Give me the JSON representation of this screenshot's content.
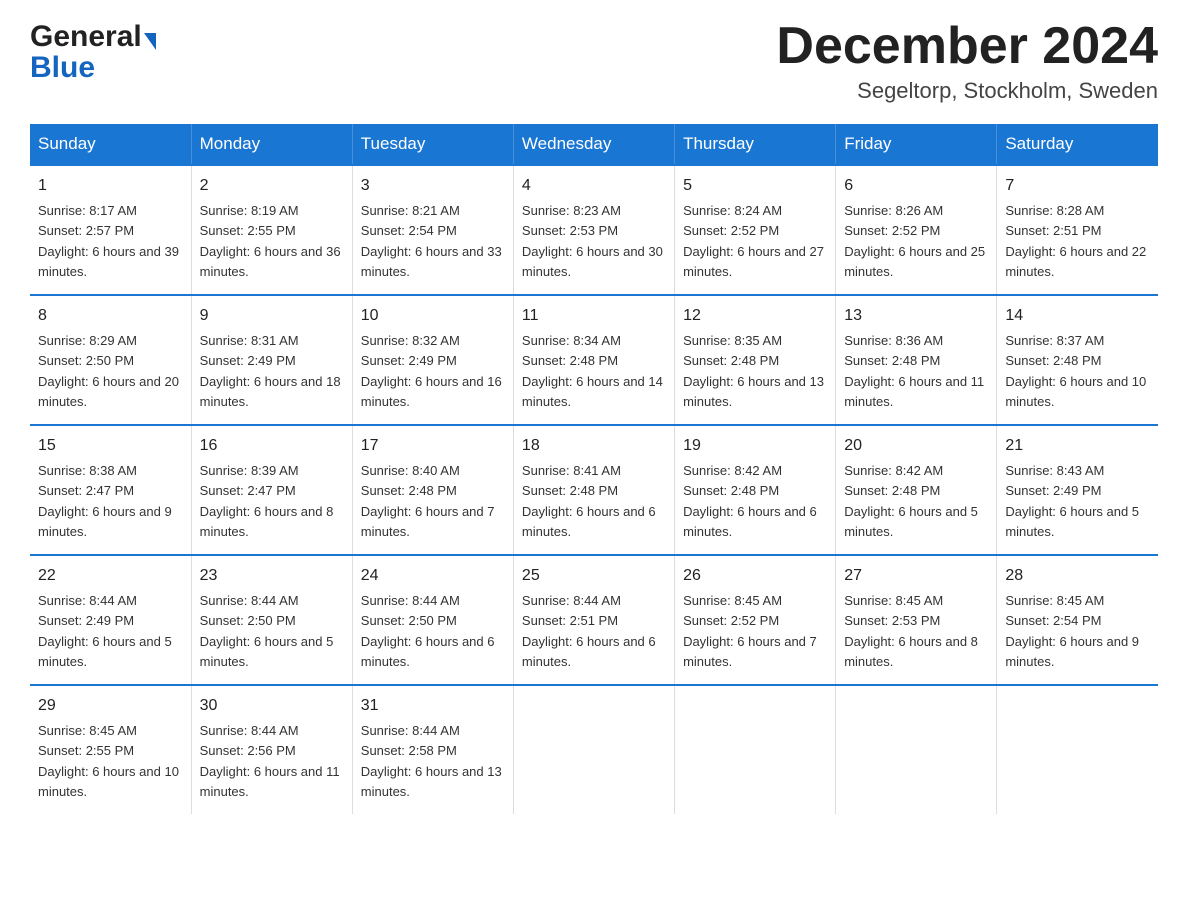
{
  "header": {
    "logo_general": "General",
    "logo_blue": "Blue",
    "month_title": "December 2024",
    "location": "Segeltorp, Stockholm, Sweden"
  },
  "weekdays": [
    "Sunday",
    "Monday",
    "Tuesday",
    "Wednesday",
    "Thursday",
    "Friday",
    "Saturday"
  ],
  "weeks": [
    [
      {
        "day": "1",
        "sunrise": "8:17 AM",
        "sunset": "2:57 PM",
        "daylight": "6 hours and 39 minutes."
      },
      {
        "day": "2",
        "sunrise": "8:19 AM",
        "sunset": "2:55 PM",
        "daylight": "6 hours and 36 minutes."
      },
      {
        "day": "3",
        "sunrise": "8:21 AM",
        "sunset": "2:54 PM",
        "daylight": "6 hours and 33 minutes."
      },
      {
        "day": "4",
        "sunrise": "8:23 AM",
        "sunset": "2:53 PM",
        "daylight": "6 hours and 30 minutes."
      },
      {
        "day": "5",
        "sunrise": "8:24 AM",
        "sunset": "2:52 PM",
        "daylight": "6 hours and 27 minutes."
      },
      {
        "day": "6",
        "sunrise": "8:26 AM",
        "sunset": "2:52 PM",
        "daylight": "6 hours and 25 minutes."
      },
      {
        "day": "7",
        "sunrise": "8:28 AM",
        "sunset": "2:51 PM",
        "daylight": "6 hours and 22 minutes."
      }
    ],
    [
      {
        "day": "8",
        "sunrise": "8:29 AM",
        "sunset": "2:50 PM",
        "daylight": "6 hours and 20 minutes."
      },
      {
        "day": "9",
        "sunrise": "8:31 AM",
        "sunset": "2:49 PM",
        "daylight": "6 hours and 18 minutes."
      },
      {
        "day": "10",
        "sunrise": "8:32 AM",
        "sunset": "2:49 PM",
        "daylight": "6 hours and 16 minutes."
      },
      {
        "day": "11",
        "sunrise": "8:34 AM",
        "sunset": "2:48 PM",
        "daylight": "6 hours and 14 minutes."
      },
      {
        "day": "12",
        "sunrise": "8:35 AM",
        "sunset": "2:48 PM",
        "daylight": "6 hours and 13 minutes."
      },
      {
        "day": "13",
        "sunrise": "8:36 AM",
        "sunset": "2:48 PM",
        "daylight": "6 hours and 11 minutes."
      },
      {
        "day": "14",
        "sunrise": "8:37 AM",
        "sunset": "2:48 PM",
        "daylight": "6 hours and 10 minutes."
      }
    ],
    [
      {
        "day": "15",
        "sunrise": "8:38 AM",
        "sunset": "2:47 PM",
        "daylight": "6 hours and 9 minutes."
      },
      {
        "day": "16",
        "sunrise": "8:39 AM",
        "sunset": "2:47 PM",
        "daylight": "6 hours and 8 minutes."
      },
      {
        "day": "17",
        "sunrise": "8:40 AM",
        "sunset": "2:48 PM",
        "daylight": "6 hours and 7 minutes."
      },
      {
        "day": "18",
        "sunrise": "8:41 AM",
        "sunset": "2:48 PM",
        "daylight": "6 hours and 6 minutes."
      },
      {
        "day": "19",
        "sunrise": "8:42 AM",
        "sunset": "2:48 PM",
        "daylight": "6 hours and 6 minutes."
      },
      {
        "day": "20",
        "sunrise": "8:42 AM",
        "sunset": "2:48 PM",
        "daylight": "6 hours and 5 minutes."
      },
      {
        "day": "21",
        "sunrise": "8:43 AM",
        "sunset": "2:49 PM",
        "daylight": "6 hours and 5 minutes."
      }
    ],
    [
      {
        "day": "22",
        "sunrise": "8:44 AM",
        "sunset": "2:49 PM",
        "daylight": "6 hours and 5 minutes."
      },
      {
        "day": "23",
        "sunrise": "8:44 AM",
        "sunset": "2:50 PM",
        "daylight": "6 hours and 5 minutes."
      },
      {
        "day": "24",
        "sunrise": "8:44 AM",
        "sunset": "2:50 PM",
        "daylight": "6 hours and 6 minutes."
      },
      {
        "day": "25",
        "sunrise": "8:44 AM",
        "sunset": "2:51 PM",
        "daylight": "6 hours and 6 minutes."
      },
      {
        "day": "26",
        "sunrise": "8:45 AM",
        "sunset": "2:52 PM",
        "daylight": "6 hours and 7 minutes."
      },
      {
        "day": "27",
        "sunrise": "8:45 AM",
        "sunset": "2:53 PM",
        "daylight": "6 hours and 8 minutes."
      },
      {
        "day": "28",
        "sunrise": "8:45 AM",
        "sunset": "2:54 PM",
        "daylight": "6 hours and 9 minutes."
      }
    ],
    [
      {
        "day": "29",
        "sunrise": "8:45 AM",
        "sunset": "2:55 PM",
        "daylight": "6 hours and 10 minutes."
      },
      {
        "day": "30",
        "sunrise": "8:44 AM",
        "sunset": "2:56 PM",
        "daylight": "6 hours and 11 minutes."
      },
      {
        "day": "31",
        "sunrise": "8:44 AM",
        "sunset": "2:58 PM",
        "daylight": "6 hours and 13 minutes."
      },
      null,
      null,
      null,
      null
    ]
  ]
}
